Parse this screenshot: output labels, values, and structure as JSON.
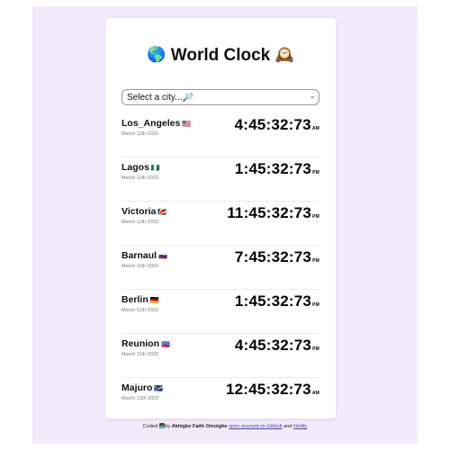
{
  "header": {
    "title": "World Clock",
    "globe_emoji": "🌎",
    "clock_emoji": "🕰️"
  },
  "search": {
    "placeholder": "Select a city...🔎"
  },
  "cities": [
    {
      "name": "Los_Angeles",
      "flag": "🇺🇸",
      "date": "March 11th 2023",
      "time": "4:45:32:73",
      "ampm": "AM"
    },
    {
      "name": "Lagos",
      "flag": "🇳🇬",
      "date": "March 11th 2023",
      "time": "1:45:32:73",
      "ampm": "PM"
    },
    {
      "name": "Victoria",
      "flag": "🇸🇨",
      "date": "March 11th 2023",
      "time": "11:45:32:73",
      "ampm": "PM"
    },
    {
      "name": "Barnaul",
      "flag": "🇷🇺",
      "date": "March 11th 2023",
      "time": "7:45:32:73",
      "ampm": "PM"
    },
    {
      "name": "Berlin",
      "flag": "🇩🇪",
      "date": "March 11th 2023",
      "time": "1:45:32:73",
      "ampm": "PM"
    },
    {
      "name": "Reunion",
      "flag": "🇷🇪",
      "date": "March 11th 2023",
      "time": "4:45:32:73",
      "ampm": "PM"
    },
    {
      "name": "Majuro",
      "flag": "🇲🇭",
      "date": "March 12th 2023",
      "time": "12:45:32:73",
      "ampm": "AM"
    }
  ],
  "footer": {
    "prefix": "Coded",
    "emoji": "👩🏾‍💻",
    "by": "by",
    "author": "Akhigbe Faith Omoighe",
    "open_source_link": "open sourced on GitHub",
    "and": "and",
    "netlify_link": "Netlify"
  },
  "colors": {
    "page_background": "#f1ebfb",
    "card_background": "#ffffff",
    "link": "#4a3fb0"
  }
}
